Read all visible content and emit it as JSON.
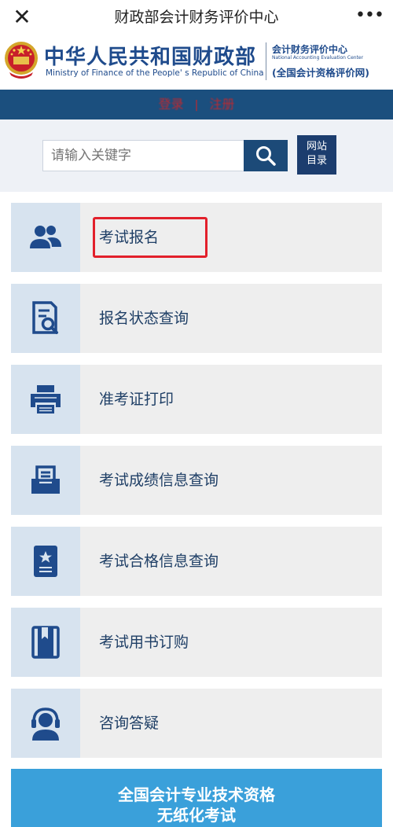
{
  "wx": {
    "close": "✕",
    "title": "财政部会计财务评价中心",
    "more": "•••"
  },
  "header": {
    "title_cn": "中华人民共和国财政部",
    "title_en": "Ministry of Finance of the People' s Republic of China",
    "center_cn": "会计财务评价中心",
    "center_en": "National Accounting Evaluation Center",
    "site_name": "(全国会计资格评价网)"
  },
  "nav": {
    "login": "登录",
    "separator": "|",
    "register": "注册"
  },
  "search": {
    "placeholder": "请输入关键字",
    "sitemap_line1": "网站",
    "sitemap_line2": "目录"
  },
  "menu": [
    {
      "label": "考试报名",
      "icon": "users-icon"
    },
    {
      "label": "报名状态查询",
      "icon": "document-search-icon"
    },
    {
      "label": "准考证打印",
      "icon": "printer-icon"
    },
    {
      "label": "考试成绩信息查询",
      "icon": "inbox-icon"
    },
    {
      "label": "考试合格信息查询",
      "icon": "certificate-icon"
    },
    {
      "label": "考试用书订购",
      "icon": "book-icon"
    },
    {
      "label": "咨询答疑",
      "icon": "headset-icon"
    }
  ],
  "banner": {
    "line1": "全国会计专业技术资格",
    "line2": "无纸化考试"
  },
  "colors": {
    "navy": "#1b4f7e",
    "icon": "#1f4b8c",
    "highlight": "#e2202b",
    "banner": "#3aa0da"
  }
}
